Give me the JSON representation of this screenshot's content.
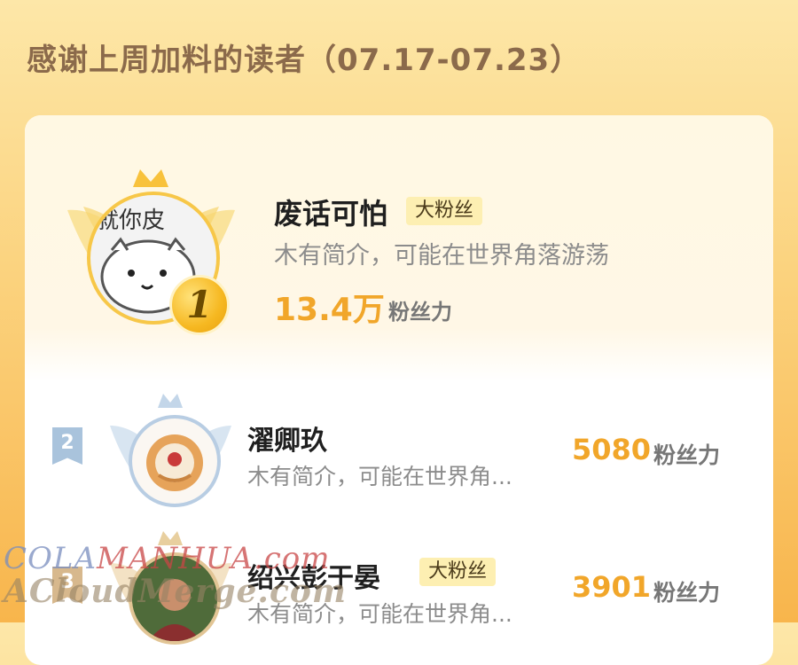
{
  "header": {
    "title": "感谢上周加料的读者（07.17-07.23）"
  },
  "rank1": {
    "rank": "1",
    "avatar_text": "就你皮",
    "name": "废话可怕",
    "badge": "大粉丝",
    "desc": "木有简介，可能在世界角落游荡",
    "fans_value": "13.4万",
    "fans_unit": "粉丝力"
  },
  "rows": [
    {
      "rank": "2",
      "name": "濯卿玖",
      "badge": "",
      "desc": "木有简介，可能在世界角...",
      "fans_value": "5080",
      "fans_unit": "粉丝力"
    },
    {
      "rank": "3",
      "name": "绍兴彭于晏",
      "badge": "大粉丝",
      "desc": "木有简介，可能在世界角...",
      "fans_value": "3901",
      "fans_unit": "粉丝力"
    }
  ],
  "watermark": {
    "line1_a": "COLA",
    "line1_b": "MANHUA.com",
    "line2": "ACloudMerge.com"
  },
  "colors": {
    "accent": "#f1a62a",
    "badge_bg": "#fdefb2",
    "silver": "#a9c3dc",
    "bronze": "#d7b88d"
  },
  "icons": {
    "crown": "crown-icon",
    "wings": "wings-icon",
    "medal": "gold-medal-icon"
  }
}
